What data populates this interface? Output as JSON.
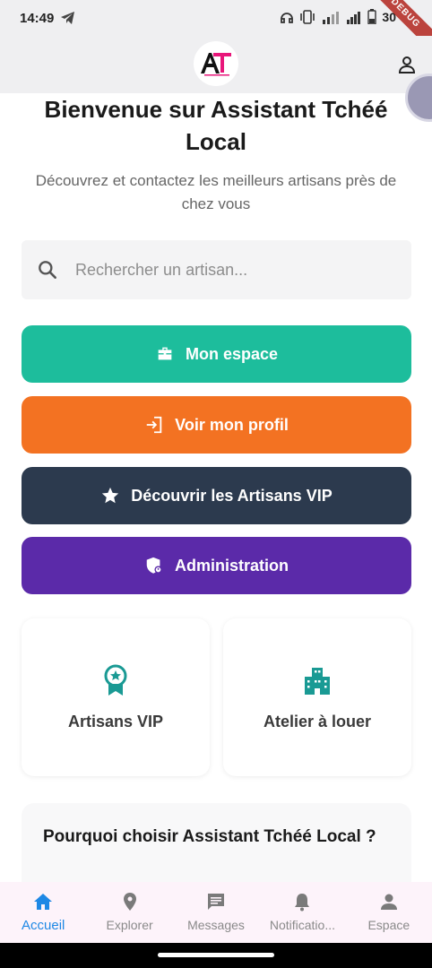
{
  "status": {
    "time": "14:49",
    "battery": "30",
    "debug": "DEBUG"
  },
  "header": {
    "logo_text": "AT"
  },
  "main": {
    "title": "Bienvenue sur Assistant Tchéé Local",
    "subtitle": "Découvrez et contactez les meilleurs artisans près de chez vous",
    "search_placeholder": "Rechercher un artisan...",
    "buttons": [
      {
        "label": "Mon espace",
        "icon": "briefcase-icon",
        "color": "#1dbd9c"
      },
      {
        "label": "Voir mon profil",
        "icon": "login-icon",
        "color": "#f37222"
      },
      {
        "label": "Découvrir les Artisans VIP",
        "icon": "star-icon",
        "color": "#2c3a4e"
      },
      {
        "label": "Administration",
        "icon": "admin-shield-icon",
        "color": "#5b2aa9"
      }
    ],
    "cards": [
      {
        "label": "Artisans VIP",
        "icon": "award-icon"
      },
      {
        "label": "Atelier à louer",
        "icon": "building-icon"
      }
    ],
    "why_title": "Pourquoi choisir Assistant Tchéé Local ?"
  },
  "bottom_nav": {
    "items": [
      {
        "label": "Accueil",
        "icon": "home-icon",
        "active": true
      },
      {
        "label": "Explorer",
        "icon": "location-pin-icon"
      },
      {
        "label": "Messages",
        "icon": "message-icon"
      },
      {
        "label": "Notificatio...",
        "icon": "bell-icon"
      },
      {
        "label": "Espace",
        "icon": "person-icon"
      }
    ]
  },
  "colors": {
    "accent_blue": "#1e88e5",
    "teal": "#1dbd9c",
    "orange": "#f37222",
    "navy": "#2c3a4e",
    "purple": "#5b2aa9",
    "icon_teal": "#1a9a94"
  }
}
